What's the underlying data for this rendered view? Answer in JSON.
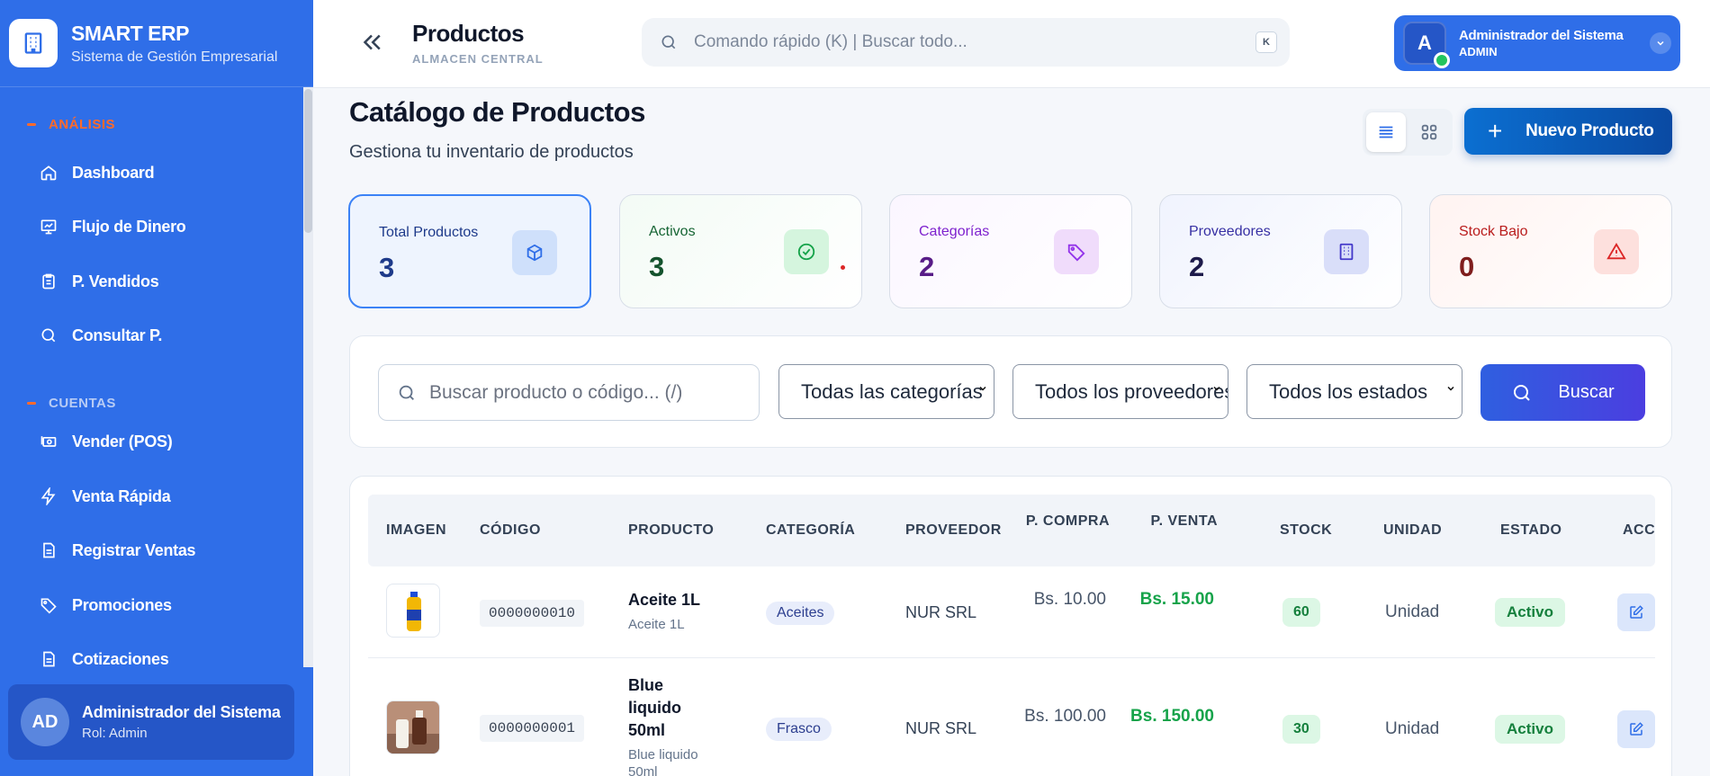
{
  "sidebar": {
    "brand_name": "SMART ERP",
    "brand_sub": "Sistema de Gestión Empresarial",
    "section_analysis": "ANÁLISIS",
    "section_accounts": "CUENTAS",
    "items": [
      {
        "label": "Dashboard",
        "icon": "home-icon"
      },
      {
        "label": "Flujo de Dinero",
        "icon": "chart-icon"
      },
      {
        "label": "P. Vendidos",
        "icon": "clipboard-icon"
      },
      {
        "label": "Consultar P.",
        "icon": "search-icon"
      },
      {
        "label": "Vender (POS)",
        "icon": "cash-icon"
      },
      {
        "label": "Venta Rápida",
        "icon": "bolt-icon"
      },
      {
        "label": "Registrar Ventas",
        "icon": "document-icon"
      },
      {
        "label": "Promociones",
        "icon": "tag-icon"
      },
      {
        "label": "Cotizaciones",
        "icon": "document-icon"
      }
    ],
    "user": {
      "initials": "AD",
      "name": "Administrador del Sistema",
      "role": "Rol: Admin"
    }
  },
  "header": {
    "title": "Productos",
    "subtitle": "ALMACEN CENTRAL",
    "search_placeholder": "Comando rápido (K) | Buscar todo...",
    "search_kbd": "K",
    "admin": {
      "initial": "A",
      "name": "Administrador del Sistema",
      "role": "ADMIN"
    }
  },
  "main": {
    "title": "Catálogo de Productos",
    "subtitle": "Gestiona tu inventario de productos",
    "new_button": "Nuevo Producto",
    "stats": [
      {
        "label": "Total Productos",
        "value": "3",
        "icon": "cube-icon"
      },
      {
        "label": "Activos",
        "value": "3",
        "icon": "check-circle-icon"
      },
      {
        "label": "Categorías",
        "value": "2",
        "icon": "tag-icon"
      },
      {
        "label": "Proveedores",
        "value": "2",
        "icon": "building-icon"
      },
      {
        "label": "Stock Bajo",
        "value": "0",
        "icon": "warning-icon"
      }
    ],
    "filters": {
      "search_placeholder": "Buscar producto o código... (/)",
      "category": "Todas las categorías",
      "supplier": "Todos los proveedores",
      "status": "Todos los estados",
      "button": "Buscar"
    },
    "table": {
      "columns": [
        "IMAGEN",
        "CÓDIGO",
        "PRODUCTO",
        "CATEGORÍA",
        "PROVEEDOR",
        "P. COMPRA",
        "P. VENTA",
        "STOCK",
        "UNIDAD",
        "ESTADO",
        "ACC"
      ],
      "rows": [
        {
          "code": "0000000010",
          "name": "Aceite 1L",
          "desc": "Aceite 1L",
          "category": "Aceites",
          "supplier": "NUR SRL",
          "buy": "Bs. 10.00",
          "sell": "Bs. 15.00",
          "stock": "60",
          "unit": "Unidad",
          "status": "Activo"
        },
        {
          "code": "0000000001",
          "name": "Blue liquido 50ml",
          "desc": "Blue liquido 50ml",
          "category": "Frasco",
          "supplier": "NUR SRL",
          "buy": "Bs. 100.00",
          "sell": "Bs. 150.00",
          "stock": "30",
          "unit": "Unidad",
          "status": "Activo"
        }
      ]
    }
  },
  "colors": {
    "sidebar": "#2f6ee8",
    "accent": "#2f6ee8",
    "success": "#16a34a",
    "danger": "#dc2626"
  }
}
